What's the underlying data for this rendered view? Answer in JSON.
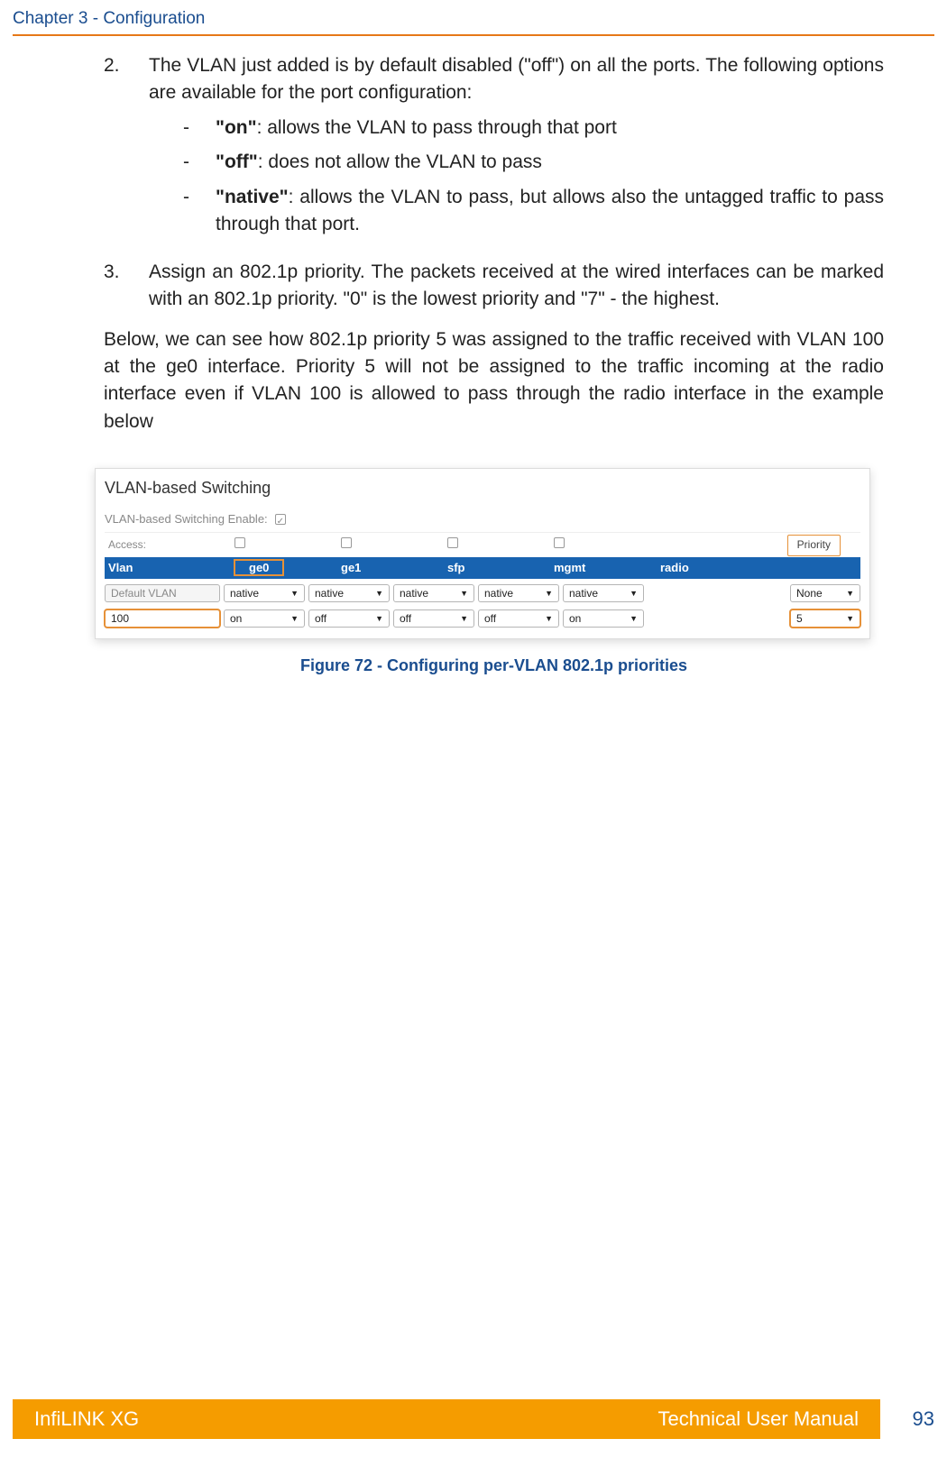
{
  "header": {
    "chapter": "Chapter 3 - Configuration"
  },
  "item2": {
    "num": "2.",
    "text_a": "The VLAN just added is by default disabled (\"off\") on all the ports. The following options are available for the port configuration:",
    "on_label": "\"on\"",
    "on_text": ": allows the VLAN to pass through that port",
    "off_label": "\"off\"",
    "off_text": ": does not allow the VLAN to pass",
    "native_label": "\"native\"",
    "native_text": ": allows the VLAN to pass, but allows also the untagged traffic to pass through that port."
  },
  "item3": {
    "num": "3.",
    "text": "Assign an 802.1p priority. The packets received at the wired interfaces can be marked with an 802.1p priority. \"0\" is the lowest priority and \"7\" - the highest."
  },
  "para_below": "Below, we can see how 802.1p priority 5 was assigned to the traffic received with VLAN 100 at the ge0 interface. Priority 5 will not be assigned to the traffic incoming at the radio interface even if VLAN 100 is allowed to pass through the radio interface in the example below",
  "shot": {
    "title": "VLAN-based Switching",
    "enable_label": "VLAN-based Switching Enable:",
    "access_label": "Access:",
    "priority_badge": "Priority",
    "cols": {
      "vlan": "Vlan",
      "ge0": "ge0",
      "ge1": "ge1",
      "sfp": "sfp",
      "mgmt": "mgmt",
      "radio": "radio"
    },
    "row1": {
      "name": "Default VLAN",
      "ge0": "native",
      "ge1": "native",
      "sfp": "native",
      "mgmt": "native",
      "radio": "native",
      "prio": "None"
    },
    "row2": {
      "name": "100",
      "ge0": "on",
      "ge1": "off",
      "sfp": "off",
      "mgmt": "off",
      "radio": "on",
      "prio": "5"
    }
  },
  "figure_caption": "Figure 72 - Configuring per-VLAN 802.1p priorities",
  "footer": {
    "left": "InfiLINK XG",
    "right": "Technical User Manual",
    "page": "93"
  }
}
